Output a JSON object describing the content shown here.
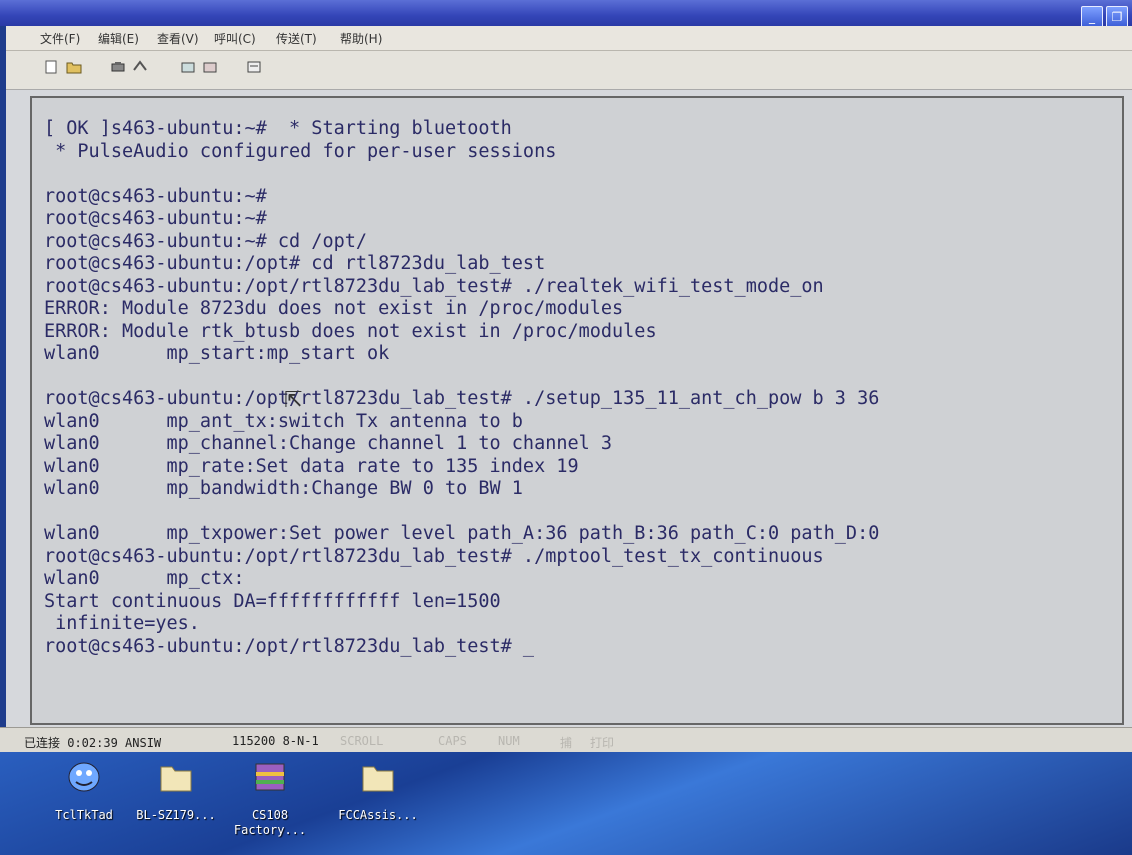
{
  "titlebar": {
    "min_icon": "minimize-icon",
    "restore_icon": "restore-icon"
  },
  "menu": [
    "文件(F)",
    "编辑(E)",
    "查看(V)",
    "呼叫(C)",
    "传送(T)",
    "帮助(H)"
  ],
  "toolbar_icons": [
    "new-icon",
    "open-icon",
    "connect-icon",
    "disconnect-icon",
    "send-icon",
    "receive-icon",
    "properties-icon"
  ],
  "terminal_lines": [
    "[ OK ]s463-ubuntu:~#  * Starting bluetooth",
    " * PulseAudio configured for per-user sessions",
    "",
    "root@cs463-ubuntu:~#",
    "root@cs463-ubuntu:~#",
    "root@cs463-ubuntu:~# cd /opt/",
    "root@cs463-ubuntu:/opt# cd rtl8723du_lab_test",
    "root@cs463-ubuntu:/opt/rtl8723du_lab_test# ./realtek_wifi_test_mode_on",
    "ERROR: Module 8723du does not exist in /proc/modules",
    "ERROR: Module rtk_btusb does not exist in /proc/modules",
    "wlan0      mp_start:mp_start ok",
    "",
    "root@cs463-ubuntu:/opt/rtl8723du_lab_test# ./setup_135_11_ant_ch_pow b 3 36",
    "wlan0      mp_ant_tx:switch Tx antenna to b",
    "wlan0      mp_channel:Change channel 1 to channel 3",
    "wlan0      mp_rate:Set data rate to 135 index 19",
    "wlan0      mp_bandwidth:Change BW 0 to BW 1",
    "",
    "wlan0      mp_txpower:Set power level path_A:36 path_B:36 path_C:0 path_D:0",
    "root@cs463-ubuntu:/opt/rtl8723du_lab_test# ./mptool_test_tx_continuous",
    "wlan0      mp_ctx:",
    "Start continuous DA=ffffffffffff len=1500",
    " infinite=yes.",
    "root@cs463-ubuntu:/opt/rtl8723du_lab_test# _"
  ],
  "status": {
    "connected": "已连接 0:02:39 ANSIW",
    "baud": "115200 8-N-1",
    "scroll": "SCROLL",
    "caps": "CAPS",
    "num": "NUM",
    "capture": "捕",
    "print": "打印"
  },
  "desktop_icons": [
    {
      "label": "TclTkTad",
      "icon": "tcltk-icon"
    },
    {
      "label": "BL-SZ179...",
      "icon": "folder-icon"
    },
    {
      "label": "CS108\nFactory...",
      "icon": "archive-icon"
    },
    {
      "label": "FCCAssis...",
      "icon": "folder-icon"
    }
  ]
}
